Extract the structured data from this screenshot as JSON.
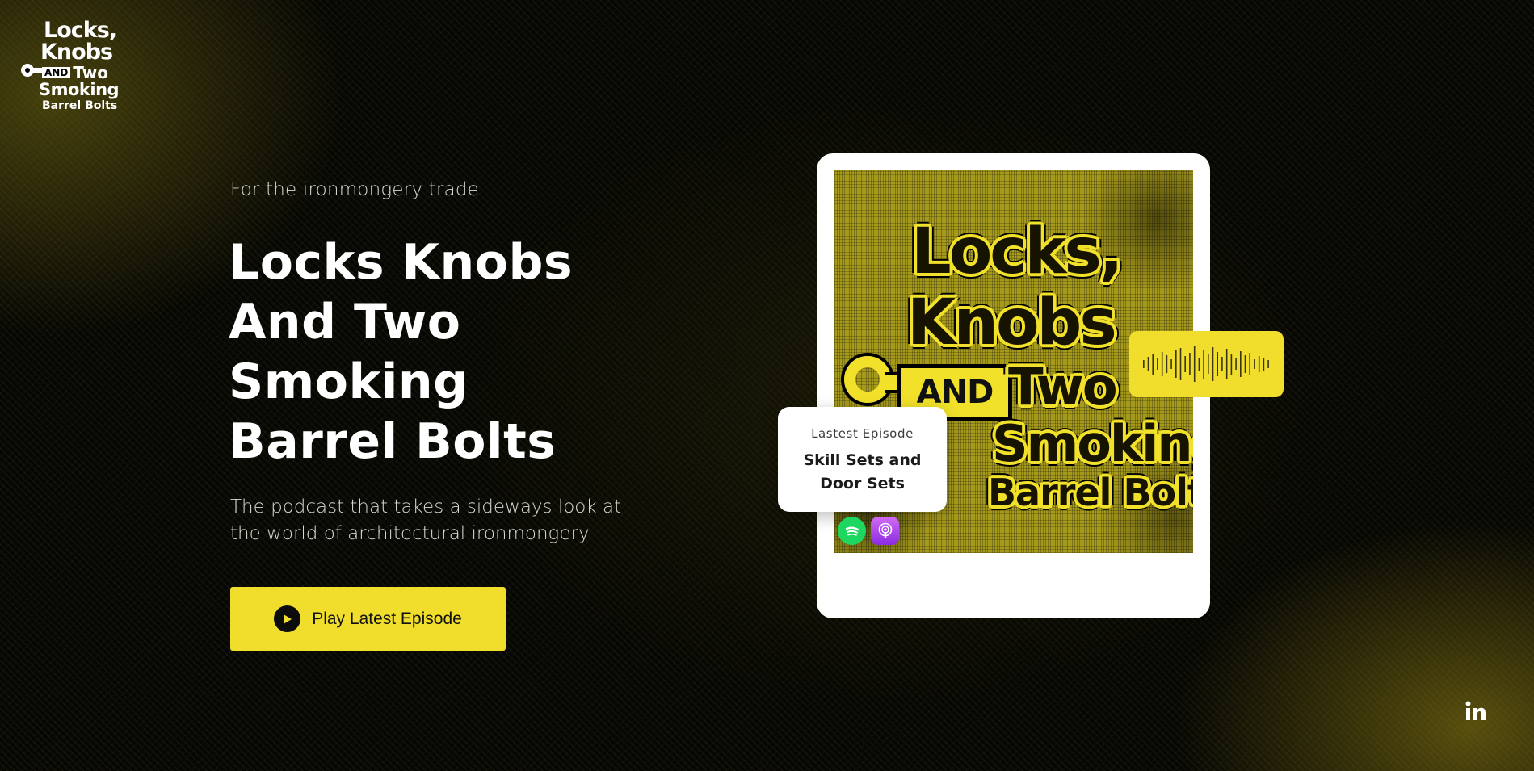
{
  "logo": {
    "line1": "Locks,",
    "line2": "Knobs",
    "and": "AND",
    "two": "Two",
    "line4": "Smoking",
    "line5": "Barrel Bolts"
  },
  "hero": {
    "eyebrow": "For the ironmongery trade",
    "title_lines": [
      "Locks Knobs",
      "And Two",
      "Smoking",
      "Barrel Bolts"
    ],
    "tagline_lines": [
      "The podcast that takes a sideways look at",
      "the world of architectural ironmongery"
    ],
    "cta_label": "Play Latest Episode"
  },
  "cover": {
    "line1": "Locks,",
    "line2": "Knobs",
    "and": "AND",
    "two": "Two",
    "line4": "Smoking",
    "line5": "Barrel Bolts"
  },
  "latest_episode": {
    "label": "Lastest Episode",
    "title": "Skill Sets and Door Sets"
  },
  "platforms": [
    "spotify-icon",
    "apple-podcasts-icon"
  ],
  "social": [
    "linkedin-icon"
  ],
  "colors": {
    "accent": "#f1dd2c",
    "background": "#060604",
    "text": "#ffffff",
    "muted_text": "#d9d9d2",
    "spotify": "#1ed760",
    "apple_podcasts": "#a845e8"
  }
}
